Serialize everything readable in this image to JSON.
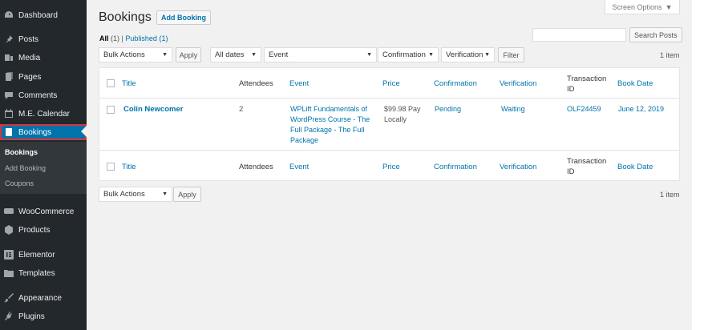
{
  "sidebar": {
    "items": [
      {
        "label": "Dashboard",
        "icon": "dashboard-icon"
      },
      {
        "label": "Posts",
        "icon": "pin-icon"
      },
      {
        "label": "Media",
        "icon": "media-icon"
      },
      {
        "label": "Pages",
        "icon": "pages-icon"
      },
      {
        "label": "Comments",
        "icon": "comment-icon"
      },
      {
        "label": "M.E. Calendar",
        "icon": "calendar-icon"
      },
      {
        "label": "Bookings",
        "icon": "book-icon"
      },
      {
        "label": "WooCommerce",
        "icon": "woo-icon"
      },
      {
        "label": "Products",
        "icon": "box-icon"
      },
      {
        "label": "Elementor",
        "icon": "elementor-icon"
      },
      {
        "label": "Templates",
        "icon": "folder-icon"
      },
      {
        "label": "Appearance",
        "icon": "brush-icon"
      },
      {
        "label": "Plugins",
        "icon": "plug-icon"
      }
    ],
    "submenu": [
      "Bookings",
      "Add Booking",
      "Coupons"
    ],
    "active_color": "#0073aa"
  },
  "header": {
    "screen_options": "Screen Options",
    "title": "Bookings",
    "add_button": "Add Booking"
  },
  "views": {
    "all": "All",
    "all_count": "(1)",
    "separator": "|",
    "published": "Published",
    "published_count": "(1)"
  },
  "search": {
    "value": "",
    "button": "Search Posts"
  },
  "filters": {
    "bulk_actions": "Bulk Actions",
    "apply": "Apply",
    "dates": "All dates",
    "event": "Event",
    "confirmation": "Confirmation",
    "verification": "Verification",
    "filter_button": "Filter",
    "items_count": "1 item"
  },
  "table": {
    "columns": [
      "Title",
      "Attendees",
      "Event",
      "Price",
      "Confirmation",
      "Verification",
      "Transaction ID",
      "Book Date"
    ],
    "transaction_line1": "Transaction",
    "transaction_line2": "ID",
    "row": {
      "title": "Colin Newcomer",
      "attendees": "2",
      "event_line1": "WPLift Fundamentals of",
      "event_line2": "WordPress Course - The",
      "event_line3": "Full Package - The Full",
      "event_line4": "Package",
      "price_line1": "$99.98 Pay",
      "price_line2": "Locally",
      "confirmation": "Pending",
      "verification": "Waiting",
      "transaction_id": "OLF24459",
      "book_date": "June 12, 2019"
    }
  },
  "bottom": {
    "bulk_actions": "Bulk Actions",
    "apply": "Apply",
    "items_count": "1 item"
  }
}
